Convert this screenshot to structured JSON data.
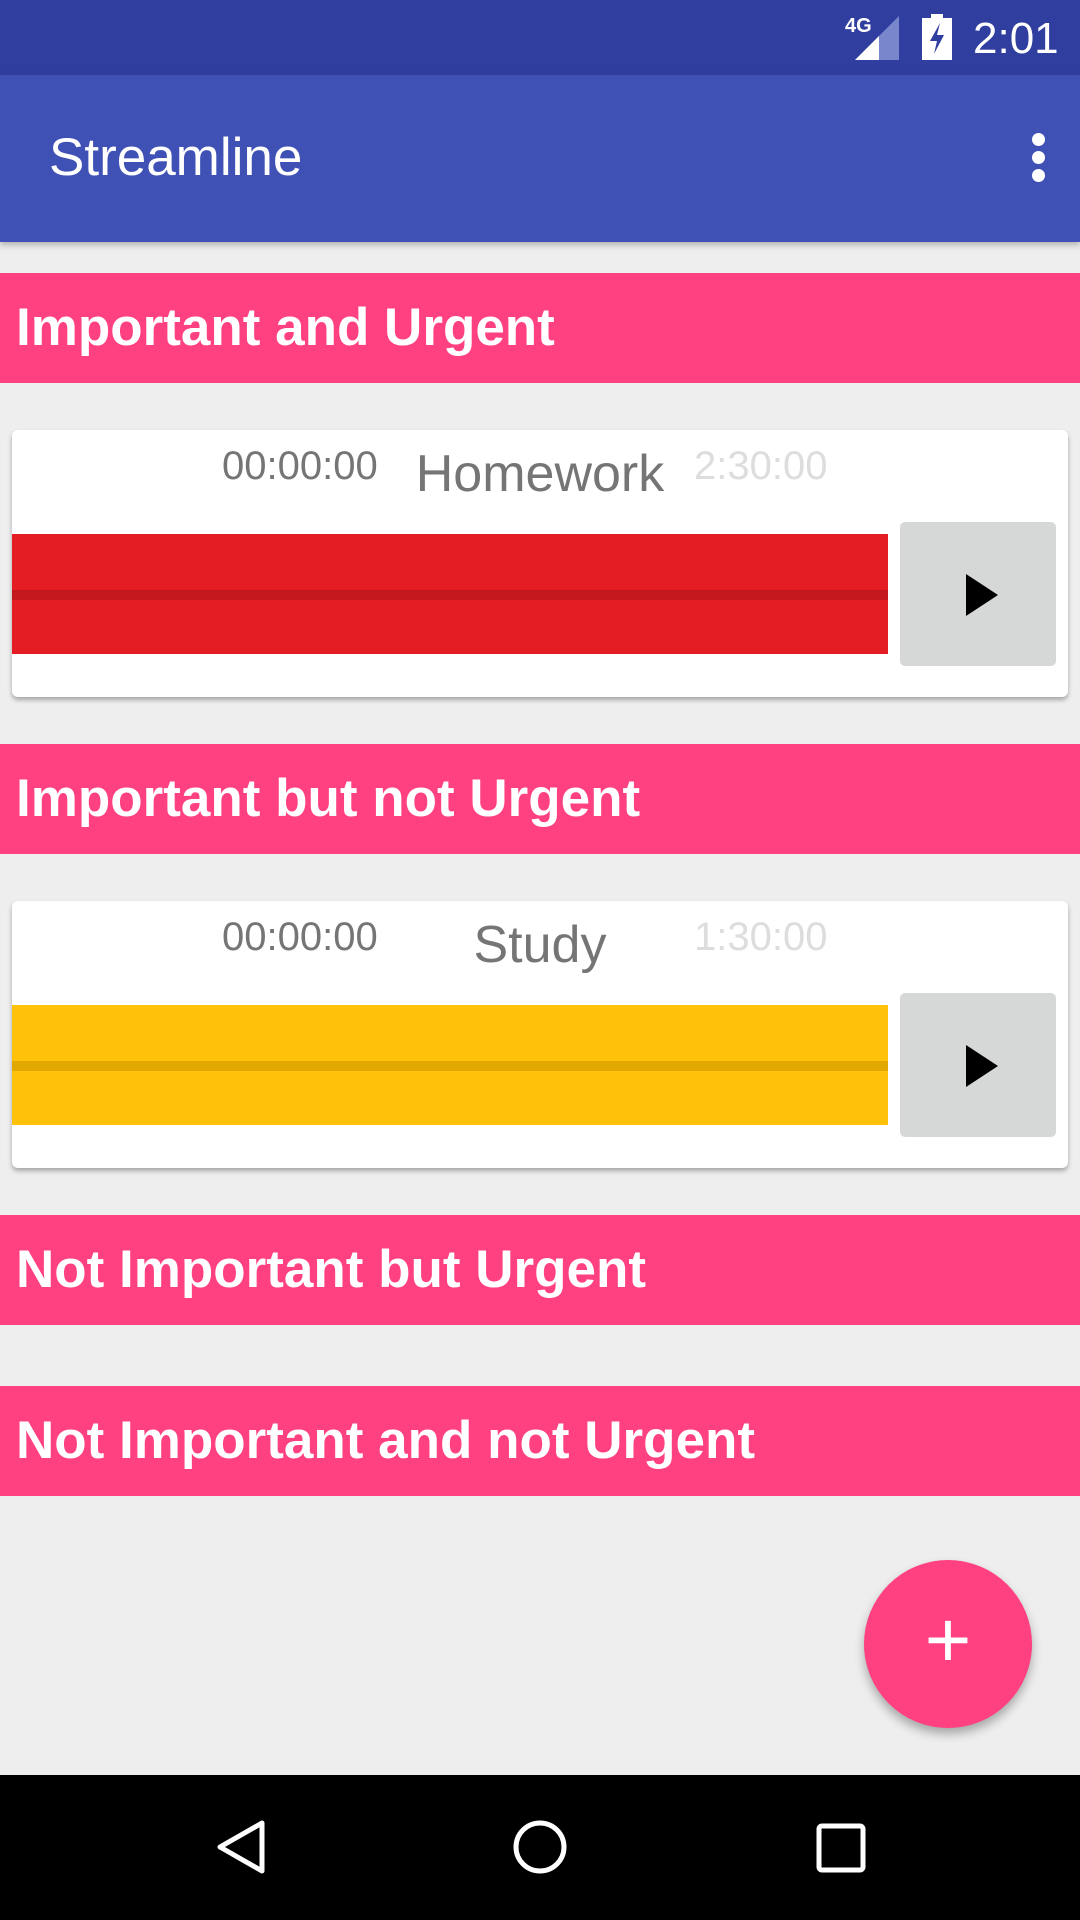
{
  "status_bar": {
    "network": "4G",
    "time": "2:01"
  },
  "app_bar": {
    "title": "Streamline"
  },
  "sections": [
    {
      "title": "Important and Urgent"
    },
    {
      "title": "Important but not Urgent"
    },
    {
      "title": "Not Important but Urgent"
    },
    {
      "title": "Not Important and not Urgent"
    }
  ],
  "tasks": [
    {
      "elapsed": "00:00:00",
      "name": "Homework",
      "duration": "2:30:00",
      "color": "#E41D25",
      "line_color": "#C4181F"
    },
    {
      "elapsed": "00:00:00",
      "name": "Study",
      "duration": "1:30:00",
      "color": "#FFC10A",
      "line_color": "#E0A800"
    }
  ],
  "fab": {
    "label": "+"
  }
}
